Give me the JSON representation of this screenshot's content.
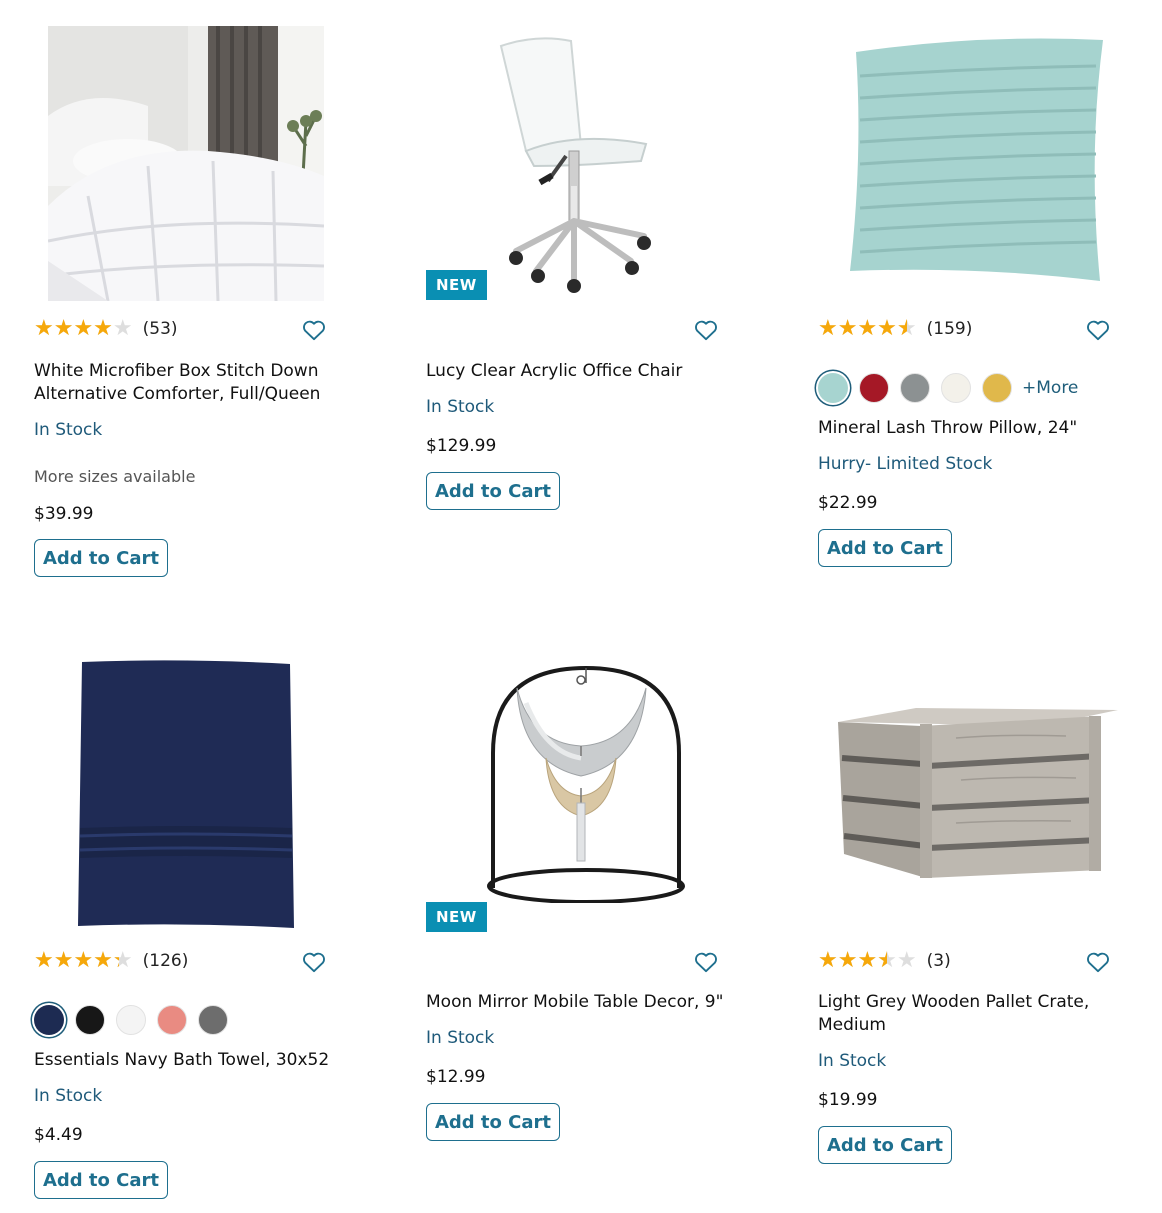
{
  "products": [
    {
      "name": "White Microfiber Box Stitch Down Alternative Comforter, Full/Queen",
      "rating": 4.0,
      "review_count": "(53)",
      "stock": "In Stock",
      "note": "More sizes available",
      "price": "$39.99",
      "cart_label": "Add to Cart"
    },
    {
      "badge": "NEW",
      "name": "Lucy Clear Acrylic Office Chair",
      "stock": "In Stock",
      "price": "$129.99",
      "cart_label": "Add to Cart"
    },
    {
      "name": "Mineral Lash Throw Pillow, 24\"",
      "rating": 4.5,
      "review_count": "(159)",
      "swatches": [
        "#a7d4d0",
        "#a51826",
        "#8c9192",
        "#f3f1ea",
        "#e0b84b"
      ],
      "more_label": "+More",
      "stock": "Hurry- Limited Stock",
      "price": "$22.99",
      "cart_label": "Add to Cart"
    },
    {
      "name": "Essentials Navy Bath Towel, 30x52",
      "rating": 4.3,
      "review_count": "(126)",
      "swatches": [
        "#1d2b52",
        "#171717",
        "#f4f4f4",
        "#e98b82",
        "#6d6d6d"
      ],
      "stock": "In Stock",
      "price": "$4.49",
      "cart_label": "Add to Cart"
    },
    {
      "badge": "NEW",
      "name": "Moon Mirror Mobile Table Decor, 9\"",
      "stock": "In Stock",
      "price": "$12.99",
      "cart_label": "Add to Cart"
    },
    {
      "name": "Light Grey Wooden Pallet Crate, Medium",
      "rating": 3.5,
      "review_count": "(3)",
      "stock": "In Stock",
      "price": "$19.99",
      "cart_label": "Add to Cart"
    }
  ],
  "icons": {
    "favorite": "heart-outline-icon",
    "rating": "star-icon"
  },
  "colors": {
    "accent": "#1e6f8e",
    "badge": "#0a8fb3",
    "star": "#f6a80a"
  }
}
